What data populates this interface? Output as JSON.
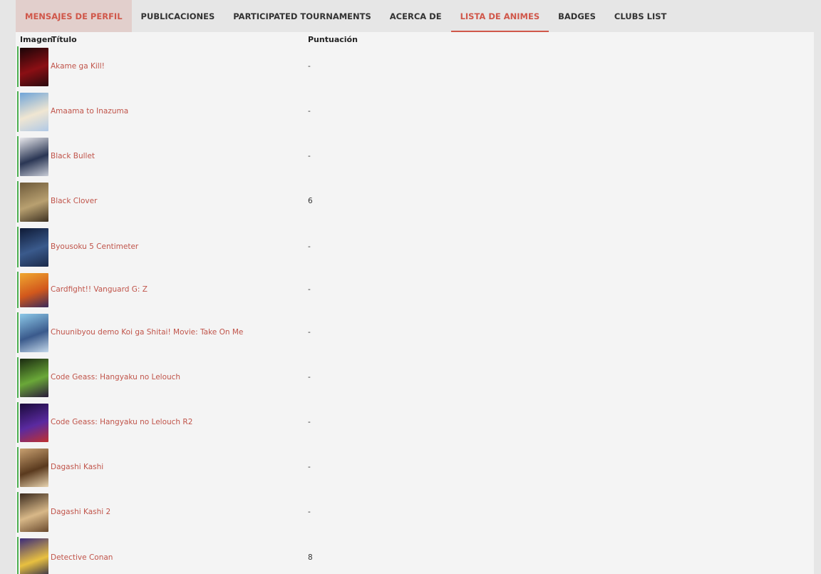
{
  "tabs": [
    {
      "label": "MENSAJES DE PERFIL"
    },
    {
      "label": "PUBLICACIONES"
    },
    {
      "label": "PARTICIPATED TOURNAMENTS"
    },
    {
      "label": "ACERCA DE"
    },
    {
      "label": "LISTA DE ANIMES"
    },
    {
      "label": "BADGES"
    },
    {
      "label": "CLUBS LIST"
    }
  ],
  "columns": {
    "image": "Imagen",
    "title": "Título",
    "score": "Puntuación"
  },
  "colors": {
    "accent": "#d0574a",
    "link": "#c0544a",
    "row_marker": "#4caf50",
    "panel_bg": "#f4f4f4"
  },
  "rows": [
    {
      "title": "Akame ga Kill!",
      "score": "-",
      "thumb_colors": [
        "#1a0508",
        "#8b0f14",
        "#2a0a0e"
      ]
    },
    {
      "title": "Amaama to Inazuma",
      "score": "-",
      "thumb_colors": [
        "#6fa4d8",
        "#f0e6d2",
        "#b0c9e6"
      ]
    },
    {
      "title": "Black Bullet",
      "score": "-",
      "thumb_colors": [
        "#e8e8ec",
        "#2a3654",
        "#c8ccd6"
      ]
    },
    {
      "title": "Black Clover",
      "score": "6",
      "thumb_colors": [
        "#6e5a3a",
        "#b8a070",
        "#3e3222"
      ]
    },
    {
      "title": "Byousoku 5 Centimeter",
      "score": "-",
      "thumb_colors": [
        "#0e1a36",
        "#3a5a8c",
        "#1a2a4a"
      ]
    },
    {
      "title": "Cardfight!! Vanguard G: Z",
      "score": "-",
      "thumb_colors": [
        "#f0a830",
        "#d2581c",
        "#3a2a5a"
      ]
    },
    {
      "title": "Chuunibyou demo Koi ga Shitai! Movie: Take On Me",
      "score": "-",
      "thumb_colors": [
        "#8cc8e8",
        "#3a5a8c",
        "#c4d8ea"
      ]
    },
    {
      "title": "Code Geass: Hangyaku no Lelouch",
      "score": "-",
      "thumb_colors": [
        "#1a2a10",
        "#6aa838",
        "#2a1a3a"
      ]
    },
    {
      "title": "Code Geass: Hangyaku no Lelouch R2",
      "score": "-",
      "thumb_colors": [
        "#1a0a3a",
        "#5a2aa0",
        "#c03030"
      ]
    },
    {
      "title": "Dagashi Kashi",
      "score": "-",
      "thumb_colors": [
        "#c8a070",
        "#5a3a1e",
        "#e8d4b0"
      ]
    },
    {
      "title": "Dagashi Kashi 2",
      "score": "-",
      "thumb_colors": [
        "#3a2a1e",
        "#d8b888",
        "#6a4a2e"
      ]
    },
    {
      "title": "Detective Conan",
      "score": "8",
      "thumb_colors": [
        "#3a2a7a",
        "#e8c040",
        "#1a1a4a"
      ]
    }
  ]
}
